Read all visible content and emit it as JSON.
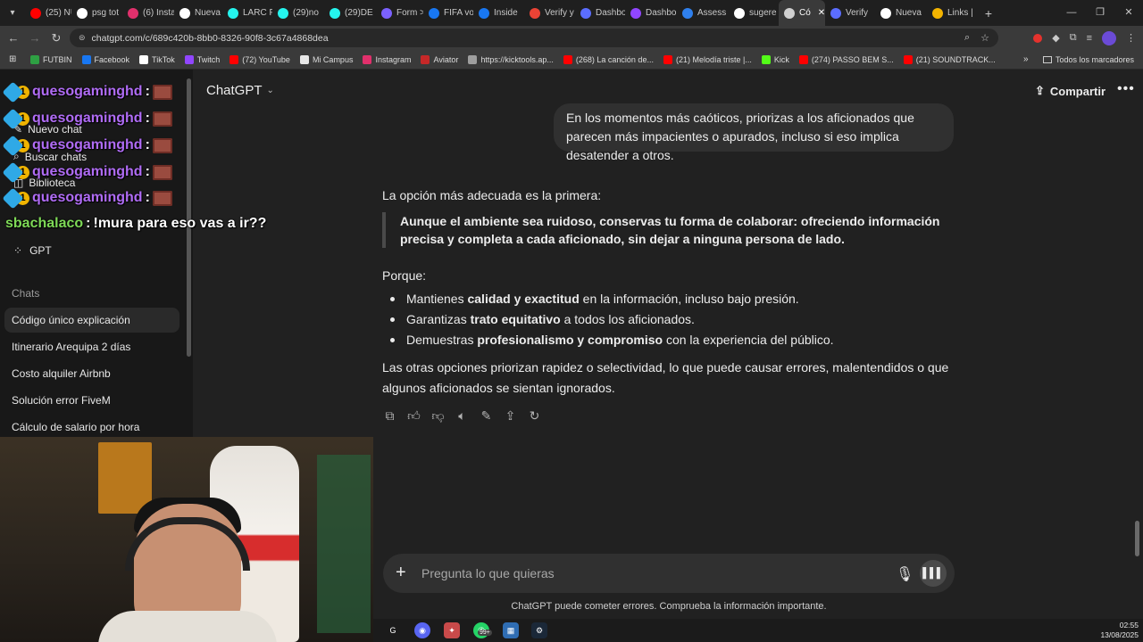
{
  "browser": {
    "tabs": [
      {
        "label": "(25) NU",
        "color": "#ff0000"
      },
      {
        "label": "psg tot",
        "color": "#ffffff"
      },
      {
        "label": "(6) Insta",
        "color": "#e1306c"
      },
      {
        "label": "Nueva",
        "color": "#ffffff"
      },
      {
        "label": "LARC P",
        "color": "#25f4ee"
      },
      {
        "label": "(29)no",
        "color": "#25f4ee"
      },
      {
        "label": "(29)DE",
        "color": "#25f4ee"
      },
      {
        "label": "Form >",
        "color": "#7b61ff"
      },
      {
        "label": "FIFA vo",
        "color": "#1877f2"
      },
      {
        "label": "Inside",
        "color": "#1877f2"
      },
      {
        "label": "Verify y",
        "color": "#ea4335"
      },
      {
        "label": "Dashbo",
        "color": "#5b6dff"
      },
      {
        "label": "Dashbo",
        "color": "#9146ff"
      },
      {
        "label": "Assess",
        "color": "#2f80ed"
      },
      {
        "label": "sugere",
        "color": "#ffffff"
      },
      {
        "label": "Có",
        "color": "#d0d0d0"
      },
      {
        "label": "Verify",
        "color": "#5b6dff"
      },
      {
        "label": "Nueva",
        "color": "#ffffff"
      },
      {
        "label": "Links |",
        "color": "#f4b400"
      }
    ],
    "active_tab_index": 15,
    "url": "chatgpt.com/c/689c420b-8bb0-8326-90f8-3c67a4868dea",
    "bookmarks": [
      {
        "label": "FUTBIN",
        "color": "#2ea043"
      },
      {
        "label": "Facebook",
        "color": "#1877f2"
      },
      {
        "label": "TikTok",
        "color": "#ffffff"
      },
      {
        "label": "Twitch",
        "color": "#9146ff"
      },
      {
        "label": "(72) YouTube",
        "color": "#ff0000"
      },
      {
        "label": "Mi Campus",
        "color": "#e8e8e8"
      },
      {
        "label": "Instagram",
        "color": "#e1306c"
      },
      {
        "label": "Aviator",
        "color": "#c62828"
      },
      {
        "label": "https://kicktools.ap...",
        "color": "#9e9e9e"
      },
      {
        "label": "(268) La canción de...",
        "color": "#ff0000"
      },
      {
        "label": "(21) Melodía triste |...",
        "color": "#ff0000"
      },
      {
        "label": "Kick",
        "color": "#53fc18"
      },
      {
        "label": "(274) PASSO BEM S...",
        "color": "#ff0000"
      },
      {
        "label": "(21) SOUNDTRACK...",
        "color": "#ff0000"
      }
    ],
    "all_bookmarks": "Todos los marcadores"
  },
  "sidebar": {
    "top_items": {
      "new_chat": "Nuevo chat",
      "search": "Buscar chats",
      "library": "Biblioteca",
      "gpt": "GPT"
    },
    "section_title": "Chats",
    "chats": [
      "Código único explicación",
      "Itinerario Arequipa 2 días",
      "Costo alquiler Airbnb",
      "Solución error FiveM",
      "Cálculo de salario por hora"
    ]
  },
  "stream_chat": {
    "repeated_user": "quesogaminghd",
    "separator": ":",
    "last_user": "sbachalaco",
    "last_message": "!mura para eso vas a ir??"
  },
  "header": {
    "model": "ChatGPT",
    "share": "Compartir"
  },
  "conversation": {
    "user_message": "En los momentos más caóticos, priorizas a los aficionados que parecen más impacientes o apurados, incluso si eso implica desatender a otros.",
    "answer_intro": "La opción más adecuada es la primera:",
    "answer_quote": "Aunque el ambiente sea ruidoso, conservas tu forma de colaborar: ofreciendo información precisa y completa a cada aficionado, sin dejar a ninguna persona de lado.",
    "because": "Porque:",
    "bullets": [
      {
        "pre": "Mantienes ",
        "bold": "calidad y exactitud",
        "post": " en la información, incluso bajo presión."
      },
      {
        "pre": "Garantizas ",
        "bold": "trato equitativo",
        "post": " a todos los aficionados."
      },
      {
        "pre": "Demuestras ",
        "bold": "profesionalismo y compromiso",
        "post": " con la experiencia del público."
      }
    ],
    "closing": "Las otras opciones priorizan rapidez o selectividad, lo que puede causar errores, malentendidos o que algunos aficionados se sientan ignorados."
  },
  "composer": {
    "placeholder": "Pregunta lo que quieras",
    "disclaimer": "ChatGPT puede cometer errores. Comprueba la información importante."
  },
  "taskbar": {
    "badge": "99+",
    "time": "02:55",
    "date": "13/08/2025"
  }
}
